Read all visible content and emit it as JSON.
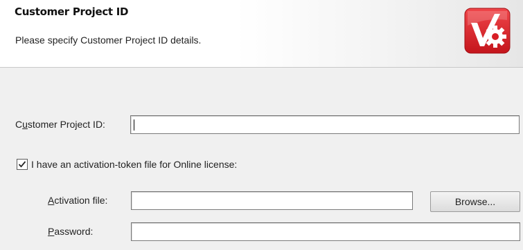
{
  "header": {
    "title": "Customer Project ID",
    "subtitle": "Please specify Customer Project ID details.",
    "logo_icon": "checkmark-gear-logo-icon",
    "logo_color": "#e0252c"
  },
  "form": {
    "customer_project_id": {
      "label_pre": "C",
      "label_access_key": "u",
      "label_post": "stomer Project ID:",
      "value": ""
    },
    "online_license_checkbox": {
      "checked": true,
      "label": "I have an activation-token file for Online license:"
    },
    "activation_file": {
      "label_access_key": "A",
      "label_post": "ctivation file:",
      "value": ""
    },
    "browse_button": {
      "label": "Browse..."
    },
    "password": {
      "label_access_key": "P",
      "label_post": "assword:",
      "value": ""
    }
  }
}
